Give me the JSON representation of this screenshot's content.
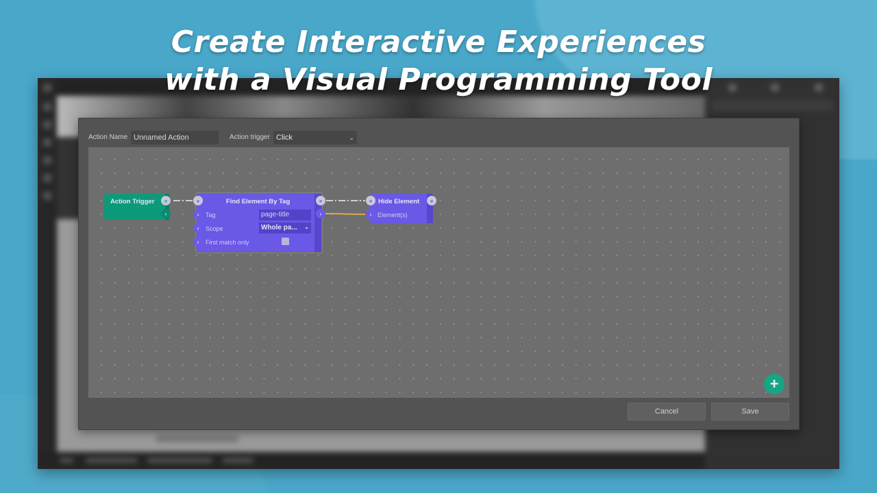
{
  "headline": {
    "line1": "Create Interactive Experiences",
    "line2": "with a Visual Programming Tool"
  },
  "dialog": {
    "action_name_label": "Action Name",
    "action_name_value": "Unnamed Action",
    "action_trigger_label": "Action trigger",
    "action_trigger_value": "Click",
    "chevron_icon": "chevron-down-icon",
    "buttons": {
      "cancel": "Cancel",
      "save": "Save"
    },
    "add_node_icon": "+"
  },
  "nodes": {
    "action_trigger": {
      "title": "Action Trigger",
      "color": "#0d9a7a"
    },
    "find_element": {
      "title": "Find Element By Tag",
      "color": "#6a58e6",
      "rows": [
        {
          "label": "Tag",
          "value": "page-title"
        },
        {
          "label": "Scope",
          "value": "Whole pa..."
        },
        {
          "label": "First match only",
          "checked": false
        }
      ]
    },
    "hide_element": {
      "title": "Hide Element",
      "color": "#6a58e6",
      "rows": [
        {
          "label": "Element(s)"
        }
      ]
    }
  },
  "connections": {
    "exec_color": "#d0d0d0",
    "data_color": "#e0a94a"
  },
  "icons": {
    "exec_port": "»",
    "data_port": "›"
  }
}
